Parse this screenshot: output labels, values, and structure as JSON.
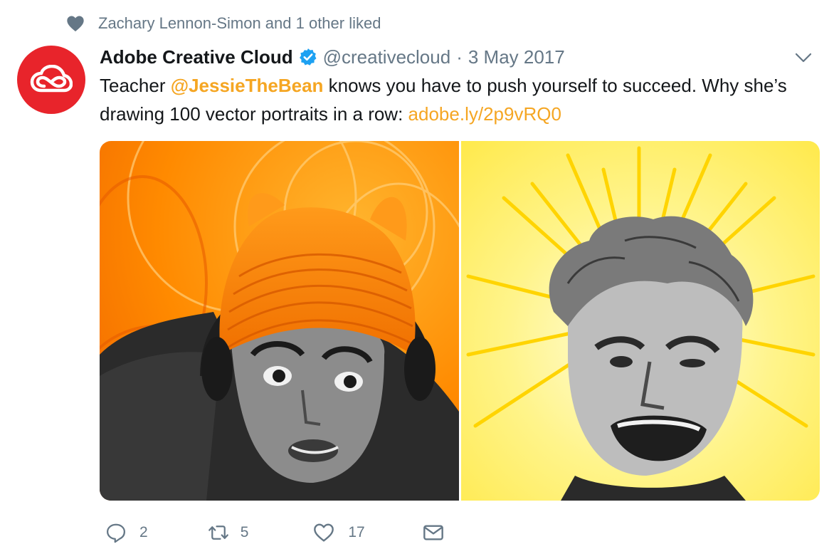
{
  "social_context": {
    "text": "Zachary Lennon-Simon and 1 other liked",
    "icon": "heart-icon"
  },
  "tweet": {
    "author_name": "Adobe Creative Cloud",
    "handle": "@creativecloud",
    "separator": "·",
    "date": "3 May 2017",
    "text_part1": "Teacher ",
    "mention": "@JessieTheBean",
    "text_part2": " knows you have to push yourself to succeed. Why she’s drawing 100 vector portraits in a row: ",
    "url": "adobe.ly/2p9vRQ0",
    "link_color": "#f5a623",
    "avatar_color": "#e8242b"
  },
  "actions": {
    "reply_count": "2",
    "retweet_count": "5",
    "like_count": "17"
  }
}
